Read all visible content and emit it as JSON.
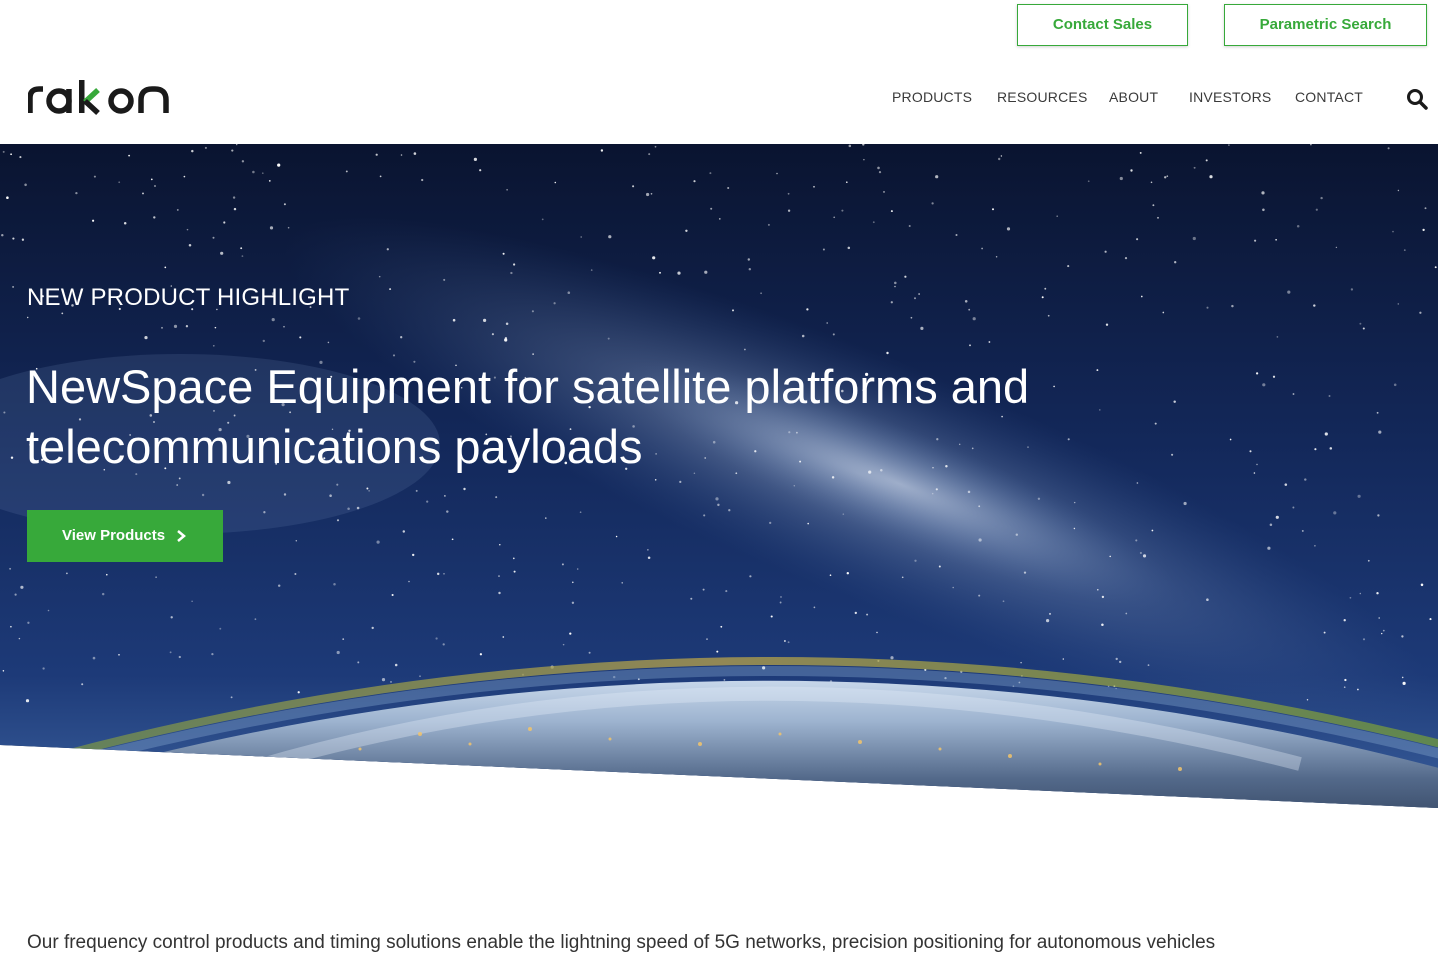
{
  "header": {
    "contact_sales": "Contact Sales",
    "parametric_search": "Parametric Search",
    "logo_text": "rakon",
    "nav": [
      "PRODUCTS",
      "RESOURCES",
      "ABOUT",
      "INVESTORS",
      "CONTACT"
    ],
    "search_icon": "search-icon"
  },
  "hero": {
    "eyebrow": "NEW PRODUCT HIGHLIGHT",
    "headline": "NewSpace Equipment for satellite platforms and telecommunications payloads",
    "cta_label": "View Products",
    "cta_icon": "chevron-right-icon"
  },
  "intro": {
    "text": "Our frequency control products and timing solutions enable the lightning speed of 5G networks, precision positioning for autonomous vehicles"
  },
  "colors": {
    "brand_green": "#37a93a",
    "brand_dark": "#1a1a1a",
    "nav_text": "#3a3a3a"
  }
}
